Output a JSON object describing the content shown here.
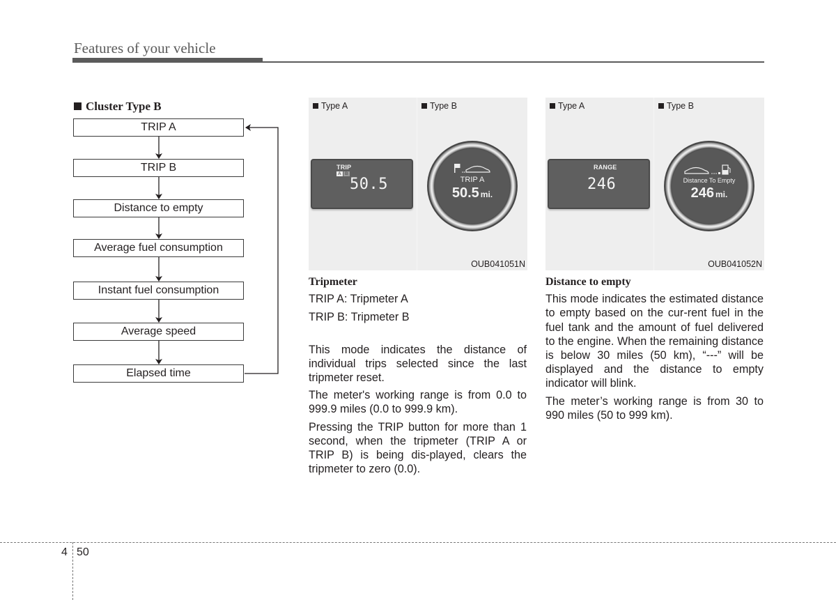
{
  "header": {
    "title": "Features of your vehicle"
  },
  "section": {
    "bullet_icon": "black-square",
    "title": "Cluster Type B"
  },
  "flowchart": {
    "steps": [
      "TRIP A",
      "TRIP B",
      "Distance to empty",
      "Average fuel consumption",
      "Instant fuel consumption",
      "Average speed",
      "Elapsed time"
    ],
    "loop_back_to": "TRIP A"
  },
  "figures": [
    {
      "type_a_label": "Type A",
      "type_b_label": "Type B",
      "code": "OUB041051N",
      "type_a_display": {
        "label": "TRIP",
        "chip_a": "A",
        "chip_b": "B",
        "value": "50.5"
      },
      "type_b_display": {
        "icons": [
          "flag-icon",
          "car-icon"
        ],
        "label": "TRIP A",
        "value": "50.5",
        "unit": "mi."
      }
    },
    {
      "type_a_label": "Type A",
      "type_b_label": "Type B",
      "code": "OUB041052N",
      "type_a_display": {
        "label": "RANGE",
        "value": "246"
      },
      "type_b_display": {
        "icons": [
          "car-icon",
          "fuel-pump-icon"
        ],
        "label": "Distance To Empty",
        "value": "246",
        "unit": "mi."
      }
    }
  ],
  "tripmeter": {
    "heading": "Tripmeter",
    "lines": [
      "TRIP A: Tripmeter A",
      "TRIP B: Tripmeter B"
    ],
    "paragraphs": [
      "This mode indicates the distance of individual trips selected since the last tripmeter reset.",
      "The meter's working range is from 0.0 to 999.9 miles (0.0 to 999.9 km).",
      "Pressing the TRIP button for more than 1 second, when the tripmeter (TRIP A or TRIP B) is being dis-played, clears the tripmeter to zero (0.0)."
    ]
  },
  "distance_to_empty": {
    "heading": "Distance to empty",
    "paragraphs": [
      "This mode indicates the estimated distance to empty based on the cur-rent fuel in the fuel tank and the amount of fuel delivered to the engine. When the remaining distance is below 30 miles (50 km), “---” will be displayed and the distance to empty indicator will blink.",
      "The meter’s working range is from 30 to 990 miles (50 to 999 km)."
    ]
  },
  "footer": {
    "chapter": "4",
    "page": "50"
  }
}
